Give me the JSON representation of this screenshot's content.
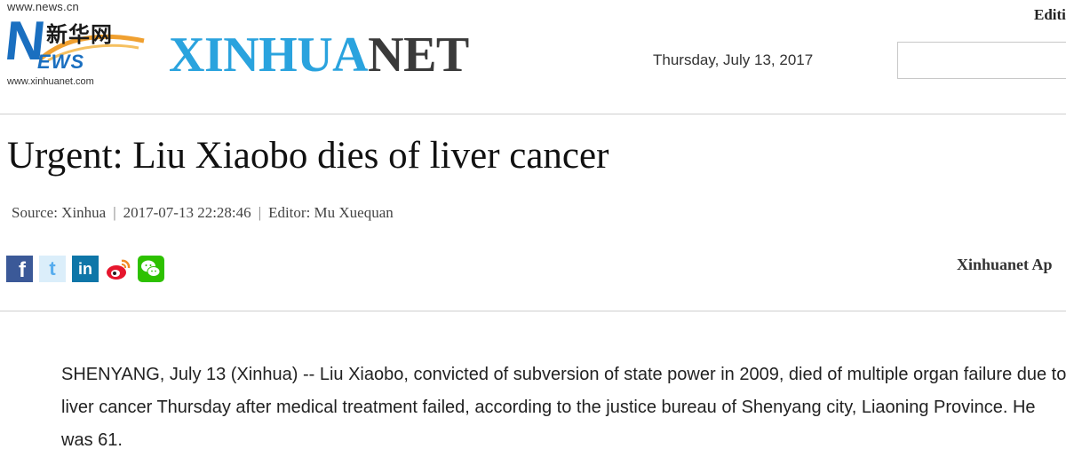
{
  "header": {
    "logo_url_top": "www.news.cn",
    "logo_n": "N",
    "logo_cn": "新华网",
    "logo_ews": "EWS",
    "logo_url_bottom": "www.xinhuanet.com",
    "brand_part1": "XINHUA",
    "brand_part2": "NET",
    "date": "Thursday, July  13, 2017",
    "edition": "Editi",
    "search_placeholder": ""
  },
  "article": {
    "headline": "Urgent: Liu Xiaobo dies of liver cancer",
    "source": "Source: Xinhua",
    "datetime": "2017-07-13 22:28:46",
    "editor": "Editor: Mu Xuequan",
    "separator": "|",
    "body": "SHENYANG, July 13 (Xinhua) -- Liu Xiaobo, convicted of subversion of state power in 2009, died of multiple organ failure due to liver cancer Thursday after medical treatment failed, according to the justice bureau of Shenyang city, Liaoning Province. He was 61."
  },
  "share": {
    "icons": [
      "facebook-icon",
      "twitter-icon",
      "linkedin-icon",
      "weibo-icon",
      "wechat-icon"
    ],
    "labels": {
      "facebook": "f",
      "twitter": "t",
      "linkedin": "in"
    },
    "colors": {
      "facebook": "#3b5998",
      "twitter": "#55acee",
      "linkedin": "#0e76a8",
      "weibo": "#e6162d",
      "wechat": "#2dc100"
    }
  },
  "sidebar": {
    "app_label": "Xinhuanet Ap"
  },
  "colors": {
    "brand_blue": "#2aa3de",
    "brand_dark": "#3a3a3a",
    "logo_blue": "#1a6fc0",
    "logo_orange": "#f0a030"
  }
}
